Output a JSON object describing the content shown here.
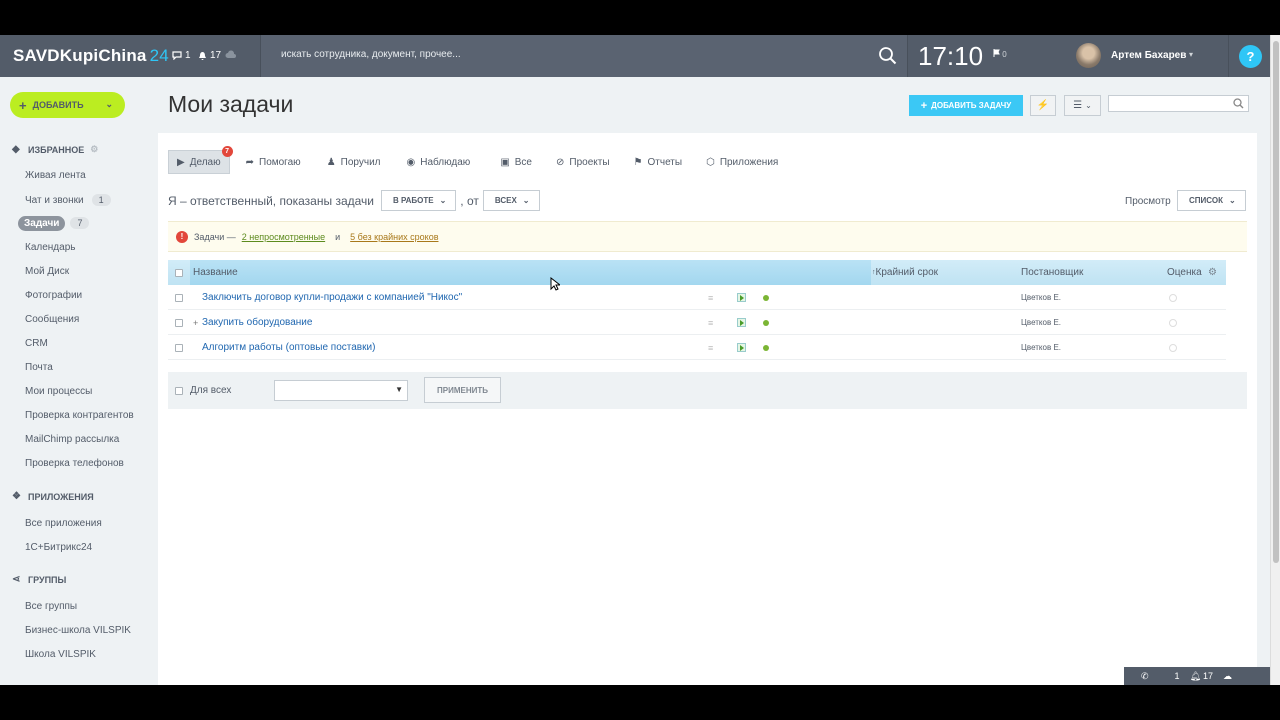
{
  "header": {
    "brand": "SAVDKupiChina",
    "brand_num": "24",
    "chat_count": "1",
    "notif_count": "17",
    "search_placeholder": "искать сотрудника, документ, прочее...",
    "time": "17:10",
    "flag_count": "0",
    "user_name": "Артем Бахарев",
    "help": "?"
  },
  "sidebar": {
    "add_label": "ДОБАВИТЬ",
    "favorites_title": "ИЗБРАННОЕ",
    "items": [
      {
        "label": "Живая лента"
      },
      {
        "label": "Чат и звонки",
        "badge": "1"
      },
      {
        "label": "Задачи",
        "badge": "7"
      },
      {
        "label": "Календарь"
      },
      {
        "label": "Мой Диск"
      },
      {
        "label": "Фотографии"
      },
      {
        "label": "Сообщения"
      },
      {
        "label": "CRM"
      },
      {
        "label": "Почта"
      },
      {
        "label": "Мои процессы"
      },
      {
        "label": "Проверка контрагентов"
      },
      {
        "label": "MailChimp рассылка"
      },
      {
        "label": "Проверка телефонов"
      }
    ],
    "apps_title": "ПРИЛОЖЕНИЯ",
    "apps": [
      {
        "label": "Все приложения"
      },
      {
        "label": "1С+Битрикс24"
      }
    ],
    "groups_title": "ГРУППЫ",
    "groups": [
      {
        "label": "Все группы"
      },
      {
        "label": "Бизнес-школа VILSPIK"
      },
      {
        "label": "Школа VILSPIK"
      }
    ]
  },
  "main": {
    "title": "Мои задачи",
    "add_task": "ДОБАВИТЬ ЗАДАЧУ",
    "tabs": [
      {
        "label": "Делаю",
        "badge": "7"
      },
      {
        "label": "Помогаю"
      },
      {
        "label": "Поручил"
      },
      {
        "label": "Наблюдаю"
      },
      {
        "label": "Все"
      },
      {
        "label": "Проекты"
      },
      {
        "label": "Отчеты"
      },
      {
        "label": "Приложения"
      }
    ],
    "filter_text": "Я – ответственный, показаны задачи",
    "filter_status": "В РАБОТЕ",
    "filter_from": ", от",
    "filter_who": "ВСЕХ",
    "view_label": "Просмотр",
    "view_value": "СПИСОК",
    "notice": {
      "prefix": "Задачи —",
      "link1": "2 непросмотренные",
      "and": "и",
      "link2": "5 без крайних сроков"
    },
    "columns": {
      "name": "Название",
      "deadline": "Крайний срок",
      "creator": "Постановщик",
      "rating": "Оценка"
    },
    "rows": [
      {
        "title": "Заключить договор купли-продажи с компанией \"Никос\"",
        "creator": "Цветков Е."
      },
      {
        "title": "Закупить оборудование",
        "creator": "Цветков Е.",
        "expand": "+"
      },
      {
        "title": "Алгоритм работы (оптовые поставки)",
        "creator": "Цветков Е."
      }
    ],
    "footer": {
      "for_all": "Для всех",
      "apply": "ПРИМЕНИТЬ"
    }
  },
  "bottombar": {
    "count1": "1",
    "count2": "17"
  },
  "colors": {
    "topbar": "#535c69",
    "accent": "#2fc6f6",
    "add_green": "#bbed21",
    "link": "#2067b0"
  }
}
